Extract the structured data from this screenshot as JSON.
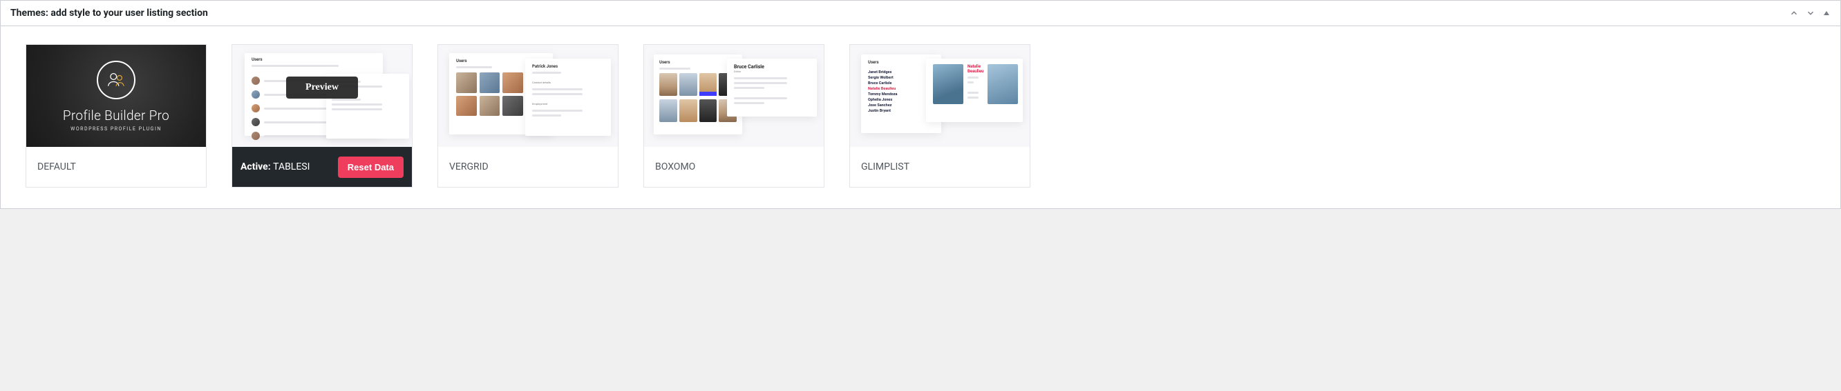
{
  "panel": {
    "title": "Themes: add style to your user listing section"
  },
  "cards": {
    "default": {
      "footer_label": "DEFAULT",
      "brand_title": "Profile Builder Pro",
      "brand_sub": "WORDPRESS PROFILE PLUGIN"
    },
    "tablesi": {
      "preview_badge": "Preview",
      "status_prefix": "Active: ",
      "status_name": "TABLESI",
      "reset_label": "Reset Data"
    },
    "vergrid": {
      "footer_label": "VERGRID",
      "mock_users_heading": "Users",
      "mock_profile_name": "Patrick Jones"
    },
    "boxomo": {
      "footer_label": "BOXOMO",
      "mock_users_heading": "Users",
      "mock_profile_name": "Bruce Carlisle"
    },
    "glimplist": {
      "footer_label": "GLIMPLIST",
      "mock_users_heading": "Users",
      "mock_profile_name": "Natalie Beaulieu",
      "mock_names": [
        "Janet Bridges",
        "Sergio Wolbert",
        "Bruce Carlisle",
        "Natalie Beaulieu",
        "Tommy Mendoza",
        "Ophelia Jones",
        "Jose Sanchez",
        "Justin Bryant"
      ]
    }
  }
}
